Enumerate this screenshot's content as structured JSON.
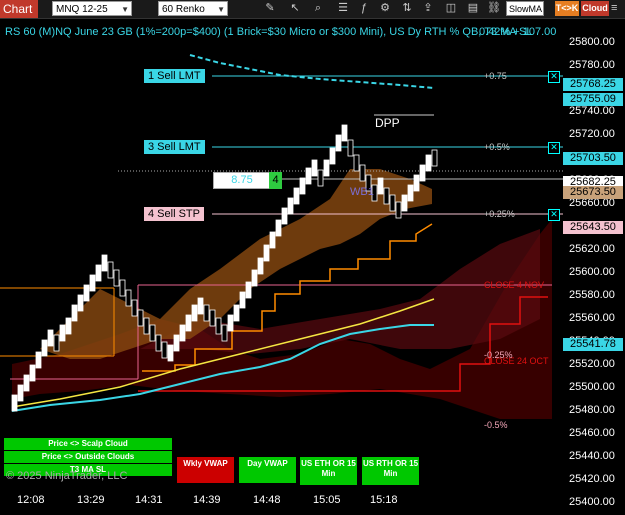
{
  "toolbar": {
    "chart_tab": "Chart",
    "instrument": "MNQ 12-25",
    "bar_type": "60 Renko",
    "indicator_select": "SlowMA",
    "tc_button": "T<>K",
    "cloud_button": "Cloud"
  },
  "chart": {
    "title": "RS 60 (M)NQ June 23 GB (1%=200p=$400) (1 Brick=$30 Micro or $300 Mini), US Dy RTH % QB, T3 MA SL",
    "title_pct": "0.42% + 107.00",
    "copyright": "© 2025 NinjaTrader, LLC",
    "dpp_label": "DPP",
    "wb_label": "WB1",
    "close_nov": "CLOSE 4 NOV",
    "close_oct": "CLOSE 24 OCT"
  },
  "orders": [
    {
      "label": "1 Sell LMT",
      "pct": "+0.75",
      "price_tag": "25768.25"
    },
    {
      "label": "3 Sell LMT",
      "pct": "+0.5%",
      "price_tag": "25703.50"
    },
    {
      "label": "4 Sell STP",
      "pct": "+0.25%",
      "price_tag": "25643.50"
    }
  ],
  "position": {
    "pnl": "8.75",
    "qty": "4"
  },
  "pct_levels": [
    "-0.25%",
    "-0.5%"
  ],
  "y_axis": {
    "ticks": [
      "25800.00",
      "25780.00",
      "25760.00",
      "25740.00",
      "25720.00",
      "25700.00",
      "25680.00",
      "25660.00",
      "25640.00",
      "25620.00",
      "25600.00",
      "25580.00",
      "25560.00",
      "25540.00",
      "25520.00",
      "25500.00",
      "25480.00",
      "25460.00",
      "25440.00",
      "25420.00",
      "25400.00"
    ],
    "tags": {
      "ma_upper": "25755.09",
      "last": "25682.25",
      "entry": "25673.50",
      "vwap": "25541.78"
    }
  },
  "x_axis": [
    "12:08",
    "13:29",
    "14:31",
    "14:39",
    "14:48",
    "15:05",
    "15:18"
  ],
  "buttons": {
    "scalp_cloud": "Price <> Scalp Cloud",
    "outside_clouds": "Price <> Outside Clouds",
    "t3_ma_sl": "T3 MA SL",
    "wkly_vwap": "Wkly VWAP",
    "day_vwap": "Day VWAP",
    "us_eth_or": "US ETH OR 15 Min",
    "us_rth_or": "US RTH OR 15 Min"
  },
  "colors": {
    "cyan": "#00e5ff",
    "order_line": "#3ad6e6",
    "stop_pink": "#f4c2cf",
    "green_btn": "#00c800",
    "red_btn": "#cc0000",
    "orange": "#ff8c00",
    "yellow": "#f5e642"
  }
}
